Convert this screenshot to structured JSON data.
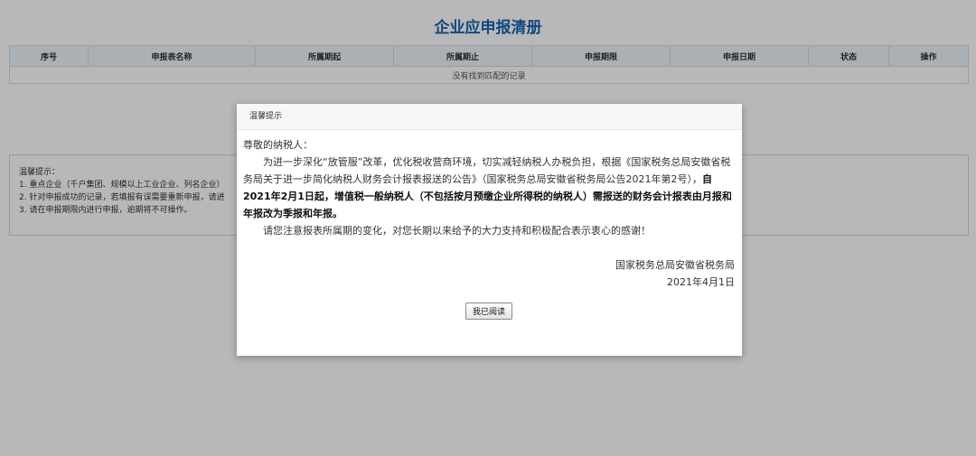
{
  "page": {
    "title": "企业应申报清册"
  },
  "table": {
    "headers": [
      "序号",
      "申报表名称",
      "所属期起",
      "所属期止",
      "申报期限",
      "申报日期",
      "状态",
      "操作"
    ],
    "empty_text": "没有找到匹配的记录"
  },
  "tips": {
    "title": "温馨提示：",
    "items": [
      "1. 重点企业（千户集团、规模以上工业企业、列名企业）",
      "2. 针对申报成功的记录，若填报有误需要重新申报，请进",
      "3. 请在申报期限内进行申报，逾期将不可操作。"
    ]
  },
  "modal": {
    "title": "温馨提示",
    "greeting": "尊敬的纳税人：",
    "paragraph_1_normal": "为进一步深化“放管服”改革，优化税收营商环境，切实减轻纳税人办税负担，根据《国家税务总局安徽省税务局关于进一步简化纳税人财务会计报表报送的公告》（国家税务总局安徽省税务局公告2021年第2号），",
    "paragraph_1_bold": "自2021年2月1日起，增值税一般纳税人（不包括按月预缴企业所得税的纳税人）需报送的财务会计报表由月报和年报改为季报和年报。",
    "paragraph_2": "请您注意报表所属期的变化，对您长期以来给予的大力支持和积极配合表示衷心的感谢！",
    "signature_org": "国家税务总局安徽省税务局",
    "signature_date": "2021年4月1日",
    "confirm_label": "我已阅读"
  },
  "colors": {
    "title_blue": "#1565b0",
    "overlay": "rgba(0,0,0,0.28)"
  }
}
